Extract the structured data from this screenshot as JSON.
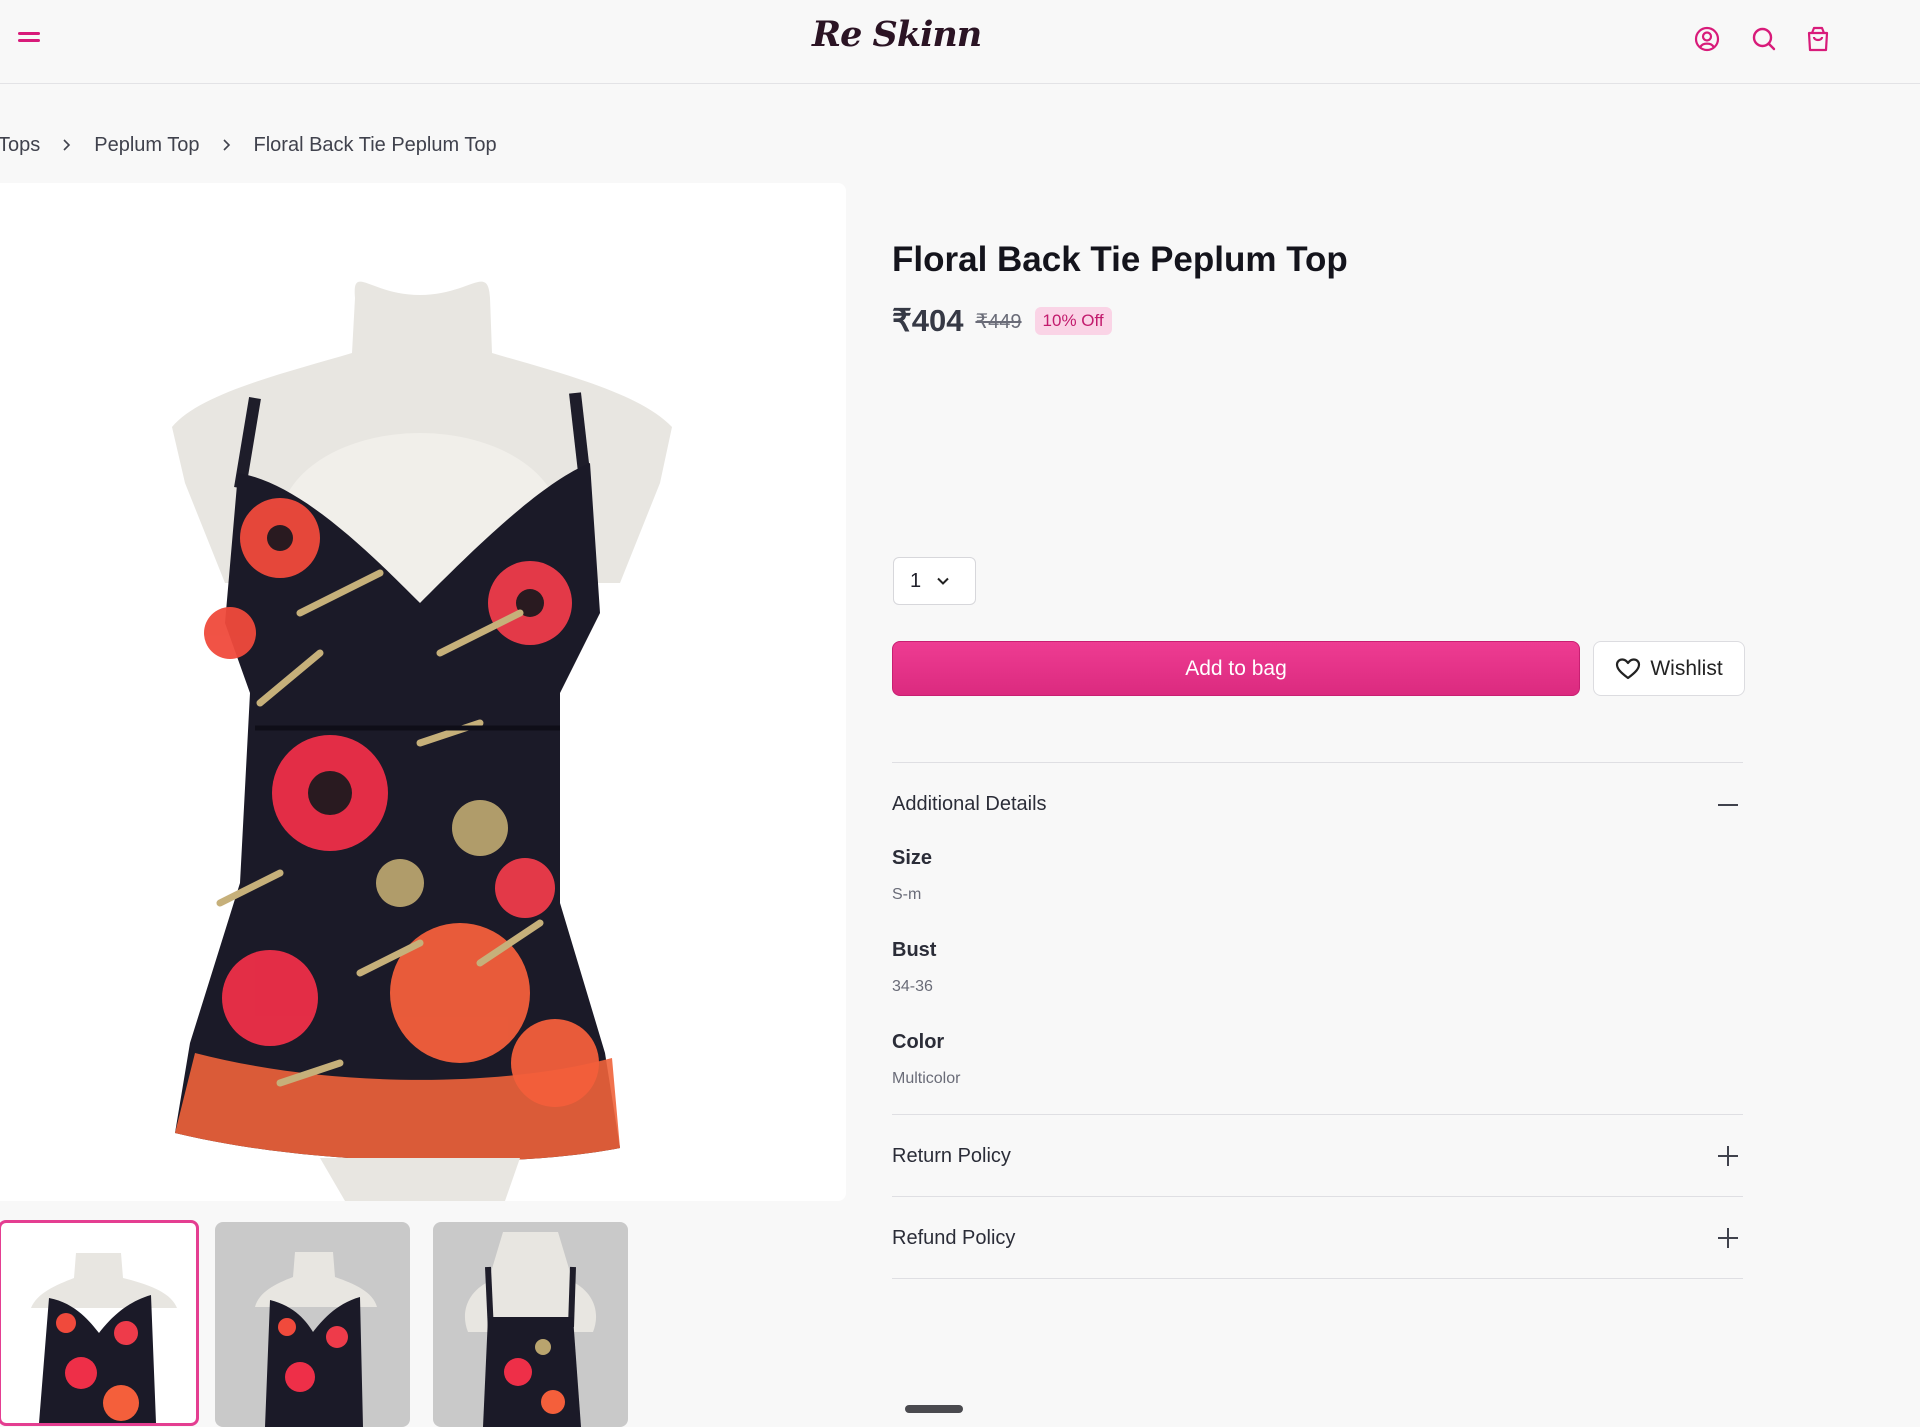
{
  "header": {
    "logo": "Re Skinn",
    "icons": [
      "menu-icon",
      "user-icon",
      "search-icon",
      "bag-icon"
    ],
    "accent": "#d81b7a"
  },
  "breadcrumb": [
    "Tops",
    "Peplum Top",
    "Floral Back Tie Peplum Top"
  ],
  "product": {
    "title": "Floral Back Tie Peplum Top",
    "price": "₹404",
    "mrp": "₹449",
    "discount": "10% Off",
    "quantity": "1"
  },
  "actions": {
    "add_to_bag": "Add to bag",
    "wishlist": "Wishlist"
  },
  "details": {
    "title": "Additional Details",
    "items": [
      {
        "label": "Size",
        "value": "S-m"
      },
      {
        "label": "Bust",
        "value": "34-36"
      },
      {
        "label": "Color",
        "value": "Multicolor"
      }
    ]
  },
  "policies": {
    "return": "Return Policy",
    "refund": "Refund Policy"
  },
  "gallery": {
    "thumbnail_count": 3,
    "active_index": 0
  }
}
